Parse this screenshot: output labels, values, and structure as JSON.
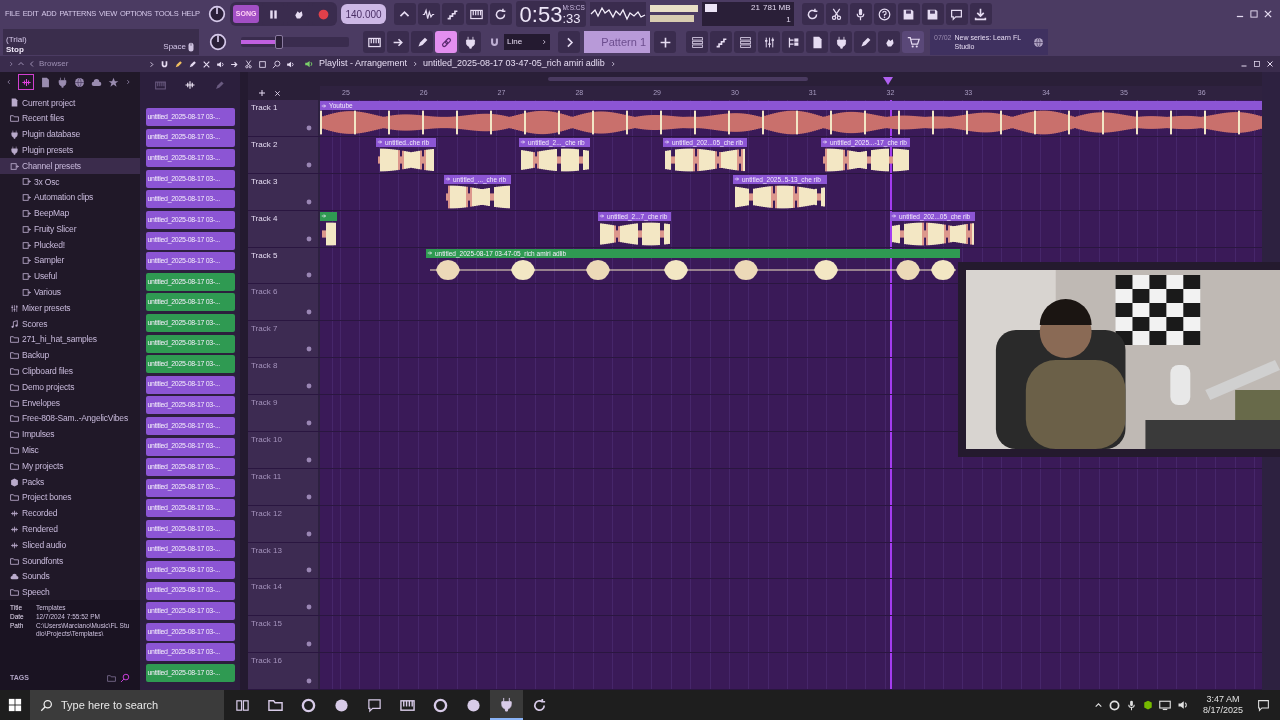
{
  "menu": [
    "FILE",
    "EDIT",
    "ADD",
    "PATTERNS",
    "VIEW",
    "OPTIONS",
    "TOOLS",
    "HELP"
  ],
  "hint": {
    "title": "(Trial)",
    "text": "Stop",
    "shortcut": "Space"
  },
  "transport": {
    "mode": "SONG",
    "tempo": "140.000",
    "time": "0:53",
    "time_fraction": ":33",
    "time_unit": "M:S:CS"
  },
  "monitor": {
    "polyphony": "21",
    "memory": "781 MB",
    "cores": "1"
  },
  "master_pitch": {
    "level": 0.35
  },
  "edit_tools": [
    {
      "selected": false
    },
    {
      "selected": false
    },
    {
      "selected": false
    },
    {
      "selected": true
    },
    {
      "selected": false
    }
  ],
  "snap": "Line",
  "pattern": "Pattern 1",
  "news": {
    "date": "07/02",
    "text": "New series: Learn FL Studio"
  },
  "browser": {
    "title": "Browser",
    "items": [
      {
        "label": "Current project",
        "kind": "project",
        "selected": false
      },
      {
        "label": "Recent files",
        "kind": "folder",
        "selected": false
      },
      {
        "label": "Plugin database",
        "kind": "plugin",
        "selected": false
      },
      {
        "label": "Plugin presets",
        "kind": "plugin",
        "selected": false
      },
      {
        "label": "Channel presets",
        "kind": "preset",
        "selected": true,
        "children": [
          {
            "label": "3x Osc",
            "kind": "preset",
            "selected": false
          },
          {
            "label": "Automation clips",
            "kind": "preset",
            "selected": false
          },
          {
            "label": "BeepMap",
            "kind": "preset",
            "selected": false
          },
          {
            "label": "Fruity Slicer",
            "kind": "preset",
            "selected": false
          },
          {
            "label": "Plucked!",
            "kind": "preset",
            "selected": false
          },
          {
            "label": "Sampler",
            "kind": "preset",
            "selected": false
          },
          {
            "label": "Useful",
            "kind": "preset",
            "selected": false
          },
          {
            "label": "Various",
            "kind": "preset",
            "selected": false
          }
        ]
      },
      {
        "label": "Mixer presets",
        "kind": "mixer",
        "selected": false
      },
      {
        "label": "Scores",
        "kind": "score",
        "selected": false
      },
      {
        "label": "271_hi_hat_samples",
        "kind": "folder",
        "selected": false
      },
      {
        "label": "Backup",
        "kind": "folder",
        "selected": false
      },
      {
        "label": "Clipboard files",
        "kind": "folder",
        "selected": false
      },
      {
        "label": "Demo projects",
        "kind": "folder",
        "selected": false
      },
      {
        "label": "Envelopes",
        "kind": "folder",
        "selected": false
      },
      {
        "label": "Free-808-Sam..-AngelicVibes",
        "kind": "folder",
        "selected": false
      },
      {
        "label": "Impulses",
        "kind": "folder",
        "selected": false
      },
      {
        "label": "Misc",
        "kind": "folder",
        "selected": false
      },
      {
        "label": "My projects",
        "kind": "folder",
        "selected": false
      },
      {
        "label": "Packs",
        "kind": "pack",
        "selected": false
      },
      {
        "label": "Project bones",
        "kind": "folder",
        "selected": false
      },
      {
        "label": "Recorded",
        "kind": "audio",
        "selected": false
      },
      {
        "label": "Rendered",
        "kind": "audio",
        "selected": false
      },
      {
        "label": "Sliced audio",
        "kind": "audio",
        "selected": false
      },
      {
        "label": "Soundfonts",
        "kind": "folder",
        "selected": false
      },
      {
        "label": "Sounds",
        "kind": "cloud",
        "selected": false
      },
      {
        "label": "Speech",
        "kind": "folder",
        "selected": false
      }
    ],
    "info": [
      {
        "label": "Title",
        "value": "Templates"
      },
      {
        "label": "Date",
        "value": "12/7/2024 7:55:52 PM"
      },
      {
        "label": "Path",
        "value": "C:\\Users\\Marciano\\Music\\FL Studio\\Projects\\Templates\\"
      }
    ],
    "tags": "TAGS"
  },
  "playlist": {
    "title": "Playlist - Arrangement",
    "pattern_name": "untitled_2025-08-17 03-47-05_rich amiri adlib",
    "patterns": [
      {
        "label": "untitled_2025-08-17 03-...",
        "color": "#8c55d4"
      },
      {
        "label": "untitled_2025-08-17 03-...",
        "color": "#8c55d4"
      },
      {
        "label": "untitled_2025-08-17 03-...",
        "color": "#8c55d4"
      },
      {
        "label": "untitled_2025-08-17 03-...",
        "color": "#8c55d4"
      },
      {
        "label": "untitled_2025-08-17 03-...",
        "color": "#8c55d4"
      },
      {
        "label": "untitled_2025-08-17 03-...",
        "color": "#8c55d4"
      },
      {
        "label": "untitled_2025-08-17 03-...",
        "color": "#8c55d4"
      },
      {
        "label": "untitled_2025-08-17 03-...",
        "color": "#8c55d4"
      },
      {
        "label": "untitled_2025-08-17 03-...",
        "color": "#2f9a52"
      },
      {
        "label": "untitled_2025-08-17 03-...",
        "color": "#2f9a52"
      },
      {
        "label": "untitled_2025-08-17 03-...",
        "color": "#2f9a52"
      },
      {
        "label": "untitled_2025-08-17 03-...",
        "color": "#2f9a52"
      },
      {
        "label": "untitled_2025-08-17 03-...",
        "color": "#2f9a52"
      },
      {
        "label": "untitled_2025-08-17 03-...",
        "color": "#8c55d4"
      },
      {
        "label": "untitled_2025-08-17 03-...",
        "color": "#8c55d4"
      },
      {
        "label": "untitled_2025-08-17 03-...",
        "color": "#8c55d4"
      },
      {
        "label": "untitled_2025-08-17 03-...",
        "color": "#8c55d4"
      },
      {
        "label": "untitled_2025-08-17 03-...",
        "color": "#8c55d4"
      },
      {
        "label": "untitled_2025-08-17 03-...",
        "color": "#8c55d4"
      },
      {
        "label": "untitled_2025-08-17 03-...",
        "color": "#8c55d4"
      },
      {
        "label": "untitled_2025-08-17 03-...",
        "color": "#8c55d4"
      },
      {
        "label": "untitled_2025-08-17 03-...",
        "color": "#8c55d4"
      },
      {
        "label": "untitled_2025-08-17 03-...",
        "color": "#8c55d4"
      },
      {
        "label": "untitled_2025-08-17 03-...",
        "color": "#8c55d4"
      },
      {
        "label": "untitled_2025-08-17 03-...",
        "color": "#8c55d4"
      },
      {
        "label": "untitled_2025-08-17 03-...",
        "color": "#8c55d4"
      },
      {
        "label": "untitled_2025-08-17 03-...",
        "color": "#8c55d4"
      },
      {
        "label": "untitled_2025-08-17 03-...",
        "color": "#2f9a52"
      }
    ],
    "ruler": [
      "25",
      "26",
      "27",
      "28",
      "29",
      "30",
      "31",
      "32",
      "33",
      "34",
      "35",
      "36"
    ],
    "tracks": [
      {
        "name": "Track 1",
        "clips": [
          {
            "label": "Youtube",
            "color": "#8c55d4",
            "kind": "full"
          }
        ]
      },
      {
        "name": "Track 2",
        "clips": [
          {
            "label": "untitled..che rib",
            "color": "#8c55d4",
            "kind": "chops"
          },
          {
            "label": "untitled_2..._che rib",
            "color": "#8c55d4",
            "kind": "chops"
          },
          {
            "label": "untitled_202...05_che rib",
            "color": "#8c55d4",
            "kind": "chops"
          },
          {
            "label": "untitled_2025...-17_che rib",
            "color": "#8c55d4",
            "kind": "chops"
          }
        ]
      },
      {
        "name": "Track 3",
        "clips": [
          {
            "label": "untitled_..._che rib",
            "color": "#8c55d4",
            "kind": "chops"
          },
          {
            "label": "untitled_2025..5-13_che rib",
            "color": "#8c55d4",
            "kind": "chops"
          }
        ]
      },
      {
        "name": "Track 4",
        "clips": [
          {
            "color": "#2f9a52",
            "kind": "chops"
          },
          {
            "label": "untitled_2...7_che rib",
            "color": "#8c55d4",
            "kind": "chops"
          },
          {
            "label": "untitled_202...05_che rib",
            "color": "#8c55d4",
            "kind": "chops"
          }
        ]
      },
      {
        "name": "Track 5",
        "clips": [
          {
            "label": "untitled_2025-08-17 03-47-05_rich amiri adlib",
            "color": "#2f9a52",
            "kind": "adlib"
          }
        ]
      },
      {
        "name": "Track 6"
      },
      {
        "name": "Track 7"
      },
      {
        "name": "Track 8"
      },
      {
        "name": "Track 9"
      },
      {
        "name": "Track 10"
      },
      {
        "name": "Track 11"
      },
      {
        "name": "Track 12"
      },
      {
        "name": "Track 13"
      },
      {
        "name": "Track 14"
      },
      {
        "name": "Track 15"
      },
      {
        "name": "Track 16"
      }
    ]
  },
  "taskbar": {
    "search_placeholder": "Type here to search",
    "time": "3:47 AM",
    "date": "8/17/2025"
  }
}
